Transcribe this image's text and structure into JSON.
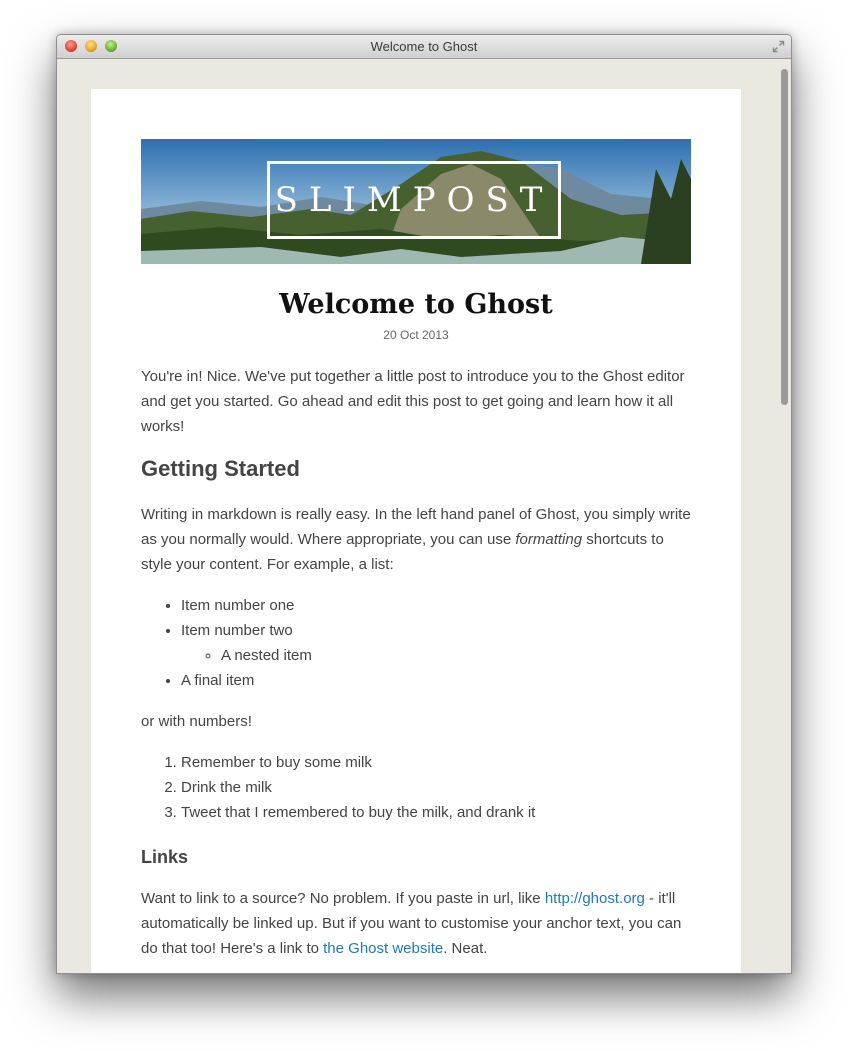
{
  "window": {
    "title": "Welcome to Ghost"
  },
  "banner": {
    "text": "SLIMPOST"
  },
  "post": {
    "title": "Welcome to Ghost",
    "date": "20 Oct 2013",
    "intro": "You're in! Nice. We've put together a little post to introduce you to the Ghost editor and get you started. Go ahead and edit this post to get going and learn how it all works!",
    "heading_getting_started": "Getting Started",
    "markdown_before": "Writing in markdown is really easy. In the left hand panel of Ghost, you simply write as you normally would. Where appropriate, you can use ",
    "markdown_em": "formatting",
    "markdown_after": " shortcuts to style your content. For example, a list:",
    "bullets": [
      "Item number one",
      "Item number two",
      "A final item"
    ],
    "nested_bullet": "A nested item",
    "numbers_intro": "or with numbers!",
    "numbered": [
      "Remember to buy some milk",
      "Drink the milk",
      "Tweet that I remembered to buy the milk, and drank it"
    ],
    "heading_links": "Links",
    "links_text_1": "Want to link to a source? No problem. If you paste in url, like ",
    "links_url": "http://ghost.org",
    "links_text_2": " - it'll automatically be linked up. But if you want to customise your anchor text, you can do that too! Here's a link to ",
    "links_anchor": "the Ghost website",
    "links_text_3": ". Neat."
  },
  "icons": {
    "close": "close-window-icon",
    "minimize": "minimize-window-icon",
    "zoom": "zoom-window-icon",
    "fullscreen": "fullscreen-arrows-icon"
  },
  "colors": {
    "page_background": "#ebe8e1",
    "link": "#1f7ab5",
    "text": "#444444"
  }
}
